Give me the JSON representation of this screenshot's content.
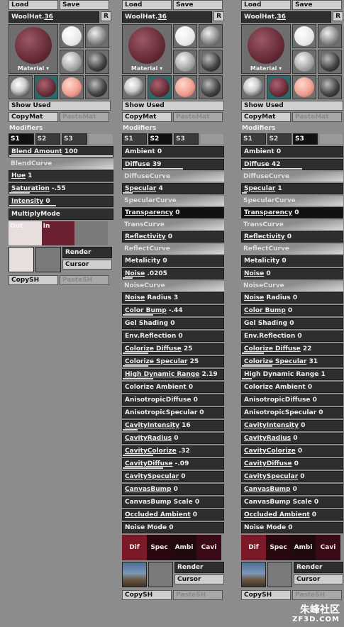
{
  "common": {
    "load": "Load",
    "save": "Save",
    "material_name": "WoolHat.",
    "material_num": "36",
    "r": "R",
    "material_label": "Material",
    "show_used": "Show Used",
    "copy_mat": "CopyMat",
    "paste_mat": "PasteMat",
    "modifiers": "Modifiers",
    "s1": "S1",
    "s2": "S2",
    "s3": "S3",
    "render": "Render",
    "cursor": "Cursor",
    "copy_sh": "CopySH",
    "paste_sh": "PasteSH"
  },
  "panel1": {
    "active_tab": "S1",
    "rows": [
      {
        "label": "Blend Amount",
        "value": "100",
        "u": true,
        "fill": 1.0
      },
      {
        "curve": "BlendCurve"
      },
      {
        "label": "Hue",
        "value": "1",
        "u": true,
        "fill": 0.0
      },
      {
        "label": "Saturation",
        "value": "-.55",
        "u": true,
        "fill": 0.2
      },
      {
        "label": "Intensity",
        "value": "0",
        "u": true,
        "fill": 0.45
      },
      {
        "label": "MultiplyMode",
        "value": "",
        "u": false,
        "fill": 0
      }
    ],
    "mix": {
      "out": "Out",
      "in": "In"
    }
  },
  "panel2": {
    "active_tab": "S2",
    "rows": [
      {
        "label": "Ambient",
        "value": "0",
        "u": false,
        "fill": 0
      },
      {
        "label": "Diffuse",
        "value": "39",
        "u": false,
        "fill": 0.6
      },
      {
        "curve": "DiffuseCurve"
      },
      {
        "label": "Specular",
        "value": "4",
        "u": true,
        "fill": 0.1
      },
      {
        "curve": "SpecularCurve"
      },
      {
        "label": "Transparency",
        "value": "0",
        "u": true,
        "fill": 0,
        "sel": true
      },
      {
        "curve": "TransCurve"
      },
      {
        "label": "Reflectivity",
        "value": "0",
        "u": true,
        "fill": 0
      },
      {
        "curve": "ReflectCurve"
      },
      {
        "label": "Metalicity",
        "value": "0",
        "u": false,
        "fill": 0
      },
      {
        "label": "Noise",
        "value": ".0205",
        "u": true,
        "fill": 0.1
      },
      {
        "curve": "NoiseCurve"
      },
      {
        "label": "Noise",
        "label2": "Radius",
        "value": "3",
        "u": true,
        "fill": 0
      },
      {
        "label": "Color Bump",
        "value": "-.44",
        "u": true,
        "fill": 0.3
      },
      {
        "label": "Gel Shading",
        "value": "0",
        "u": false,
        "fill": 0
      },
      {
        "label": "Env.Reflection",
        "value": "0",
        "u": false,
        "fill": 0
      },
      {
        "label": "Colorize Diffuse",
        "value": "25",
        "u": true,
        "fill": 0.25
      },
      {
        "label": "Colorize Specular",
        "value": "25",
        "u": true,
        "fill": 0.25
      },
      {
        "label": "High Dynamic Range",
        "value": "2.19",
        "u": true,
        "fill": 0.3
      },
      {
        "label": "Colorize Ambient",
        "value": "0",
        "u": false,
        "fill": 0
      },
      {
        "label": "AnisotropicDiffuse",
        "value": "0",
        "u": false,
        "fill": 0
      },
      {
        "label": "AnisotropicSpecular",
        "value": "0",
        "u": false,
        "fill": 0
      },
      {
        "label": "CavityIntensity",
        "value": "16",
        "u": true,
        "fill": 0.15
      },
      {
        "label": "CavityRadius",
        "value": "0",
        "u": true,
        "fill": 0
      },
      {
        "label": "CavityColorize",
        "value": ".32",
        "u": true,
        "fill": 0.3
      },
      {
        "label": "CavityDiffuse",
        "value": "-.09",
        "u": true,
        "fill": 0.4
      },
      {
        "label": "CavitySpecular",
        "value": "0",
        "u": true,
        "fill": 0
      },
      {
        "label": "CanvasBump",
        "value": "0",
        "u": true,
        "fill": 0
      },
      {
        "label": "CanvasBump Scale",
        "value": "0",
        "u": false,
        "fill": 0
      },
      {
        "label": "Occluded Ambient",
        "value": "0",
        "u": true,
        "fill": 0
      },
      {
        "label": "Noise Mode",
        "value": "0",
        "u": false,
        "fill": 0
      }
    ],
    "strip": [
      "Dif",
      "Spec",
      "Ambi",
      "Cavi"
    ]
  },
  "panel3": {
    "active_tab": "S3",
    "rows": [
      {
        "label": "Ambient",
        "value": "0",
        "u": false,
        "fill": 0
      },
      {
        "label": "Diffuse",
        "value": "42",
        "u": false,
        "fill": 0.6
      },
      {
        "curve": "DiffuseCurve"
      },
      {
        "label": "Specular",
        "value": "1",
        "u": true,
        "fill": 0.05
      },
      {
        "curve": "SpecularCurve"
      },
      {
        "label": "Transparency",
        "value": "0",
        "u": true,
        "fill": 0,
        "sel": true
      },
      {
        "curve": "TransCurve"
      },
      {
        "label": "Reflectivity",
        "value": "0",
        "u": true,
        "fill": 0
      },
      {
        "curve": "ReflectCurve"
      },
      {
        "label": "Metalicity",
        "value": "0",
        "u": false,
        "fill": 0
      },
      {
        "label": "Noise",
        "value": "0",
        "u": true,
        "fill": 0
      },
      {
        "curve": "NoiseCurve"
      },
      {
        "label": "Noise",
        "label2": "Radius",
        "value": "0",
        "u": true,
        "fill": 0
      },
      {
        "label": "Color Bump",
        "value": "0",
        "u": true,
        "fill": 0
      },
      {
        "label": "Gel Shading",
        "value": "0",
        "u": false,
        "fill": 0
      },
      {
        "label": "Env.Reflection",
        "value": "0",
        "u": false,
        "fill": 0
      },
      {
        "label": "Colorize Diffuse",
        "value": "22",
        "u": true,
        "fill": 0.22
      },
      {
        "label": "Colorize Specular",
        "value": "31",
        "u": true,
        "fill": 0.3
      },
      {
        "label": "High Dynamic Range",
        "value": "1",
        "u": false,
        "fill": 0.1
      },
      {
        "label": "Colorize Ambient",
        "value": "0",
        "u": false,
        "fill": 0
      },
      {
        "label": "AnisotropicDiffuse",
        "value": "0",
        "u": false,
        "fill": 0
      },
      {
        "label": "AnisotropicSpecular",
        "value": "0",
        "u": false,
        "fill": 0
      },
      {
        "label": "CavityIntensity",
        "value": "0",
        "u": true,
        "fill": 0
      },
      {
        "label": "CavityRadius",
        "value": "0",
        "u": true,
        "fill": 0
      },
      {
        "label": "CavityColorize",
        "value": "0",
        "u": true,
        "fill": 0
      },
      {
        "label": "CavityDiffuse",
        "value": "0",
        "u": true,
        "fill": 0
      },
      {
        "label": "CavitySpecular",
        "value": "0",
        "u": true,
        "fill": 0
      },
      {
        "label": "CanvasBump",
        "value": "0",
        "u": true,
        "fill": 0
      },
      {
        "label": "CanvasBump Scale",
        "value": "0",
        "u": false,
        "fill": 0
      },
      {
        "label": "Occluded Ambient",
        "value": "0",
        "u": true,
        "fill": 0
      },
      {
        "label": "Noise Mode",
        "value": "0",
        "u": false,
        "fill": 0
      }
    ],
    "strip": [
      "Dif",
      "Spec",
      "Ambi",
      "Cavi"
    ]
  },
  "watermark": {
    "cn": "朱峰社区",
    "url": "ZF3D.COM"
  }
}
